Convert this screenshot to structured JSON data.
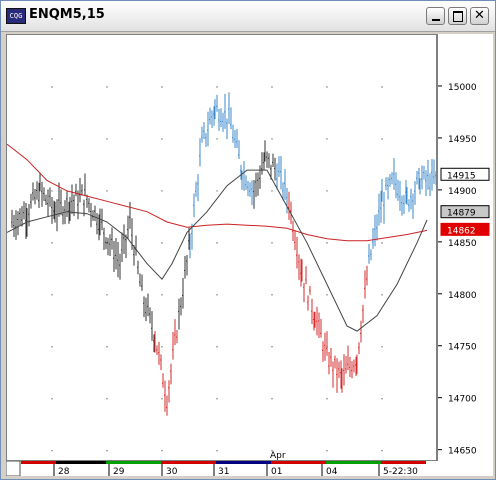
{
  "window": {
    "title": "ENQM5,15",
    "icon": "app-icon",
    "icon_text": "CQG",
    "buttons": [
      "minimize-icon",
      "maximize-icon",
      "close-icon"
    ]
  },
  "colors": {
    "up_bars": "#3b88c8",
    "down_bars": "#d62b2b",
    "neutral_bars": "#333333",
    "ma_red": "#cc2222",
    "ma_black": "#444444",
    "grid": "#888888"
  },
  "chart_data": {
    "type": "line",
    "title": "ENQM5,15",
    "price_ticks": [
      "15000",
      "14950",
      "14900",
      "14850",
      "14800",
      "14750",
      "14700",
      "14650"
    ],
    "price_tick_values": [
      15000,
      14950,
      14900,
      14850,
      14800,
      14750,
      14700,
      14650
    ],
    "ylim": [
      14641,
      15050
    ],
    "price_badges": [
      {
        "label": "14915",
        "value": 14915,
        "style": "black-on-white"
      },
      {
        "label": "14879",
        "value": 14879,
        "style": "black-on-gray"
      },
      {
        "label": "14862",
        "value": 14862,
        "style": "white-on-red"
      }
    ],
    "time_labels": [
      "28",
      "29",
      "30",
      "31",
      "01",
      "04",
      "5-22:30"
    ],
    "month_label": "Apr",
    "xlim": [
      0,
      430
    ],
    "series": [
      {
        "name": "bars",
        "x": [
          5,
          20,
          33,
          48,
          63,
          78,
          93,
          103,
          113,
          123,
          135,
          148,
          160,
          172,
          183,
          195,
          208,
          222,
          235,
          247,
          258,
          270,
          282,
          295,
          308,
          320,
          335,
          350,
          362,
          375,
          387,
          400,
          413,
          425
        ],
        "values": [
          14870,
          14880,
          14900,
          14880,
          14890,
          14895,
          14870,
          14850,
          14830,
          14870,
          14800,
          14760,
          14700,
          14780,
          14850,
          14945,
          14980,
          14970,
          14920,
          14900,
          14930,
          14920,
          14890,
          14820,
          14780,
          14740,
          14720,
          14740,
          14830,
          14890,
          14910,
          14890,
          14910,
          14910
        ],
        "colors": [
          "n",
          "n",
          "n",
          "n",
          "n",
          "n",
          "n",
          "n",
          "n",
          "n",
          "n",
          "r",
          "r",
          "n",
          "b",
          "b",
          "b",
          "b",
          "b",
          "n",
          "n",
          "b",
          "r",
          "r",
          "r",
          "r",
          "r",
          "r",
          "b",
          "b",
          "b",
          "b",
          "b",
          "b"
        ]
      },
      {
        "name": "ma_red",
        "x": [
          0,
          20,
          40,
          60,
          80,
          100,
          120,
          140,
          160,
          180,
          200,
          220,
          240,
          260,
          280,
          300,
          320,
          340,
          360,
          380,
          400,
          420
        ],
        "values": [
          14945,
          14930,
          14910,
          14900,
          14895,
          14890,
          14885,
          14880,
          14870,
          14865,
          14867,
          14868,
          14867,
          14866,
          14864,
          14858,
          14854,
          14852,
          14852,
          14855,
          14858,
          14862
        ]
      },
      {
        "name": "ma_black",
        "x": [
          0,
          20,
          40,
          60,
          80,
          100,
          120,
          140,
          155,
          165,
          180,
          200,
          220,
          240,
          260,
          280,
          300,
          320,
          340,
          350,
          370,
          390,
          410,
          420
        ],
        "values": [
          14860,
          14870,
          14875,
          14880,
          14878,
          14870,
          14855,
          14830,
          14815,
          14830,
          14860,
          14880,
          14905,
          14920,
          14920,
          14885,
          14850,
          14810,
          14770,
          14765,
          14780,
          14810,
          14850,
          14872
        ]
      }
    ]
  }
}
